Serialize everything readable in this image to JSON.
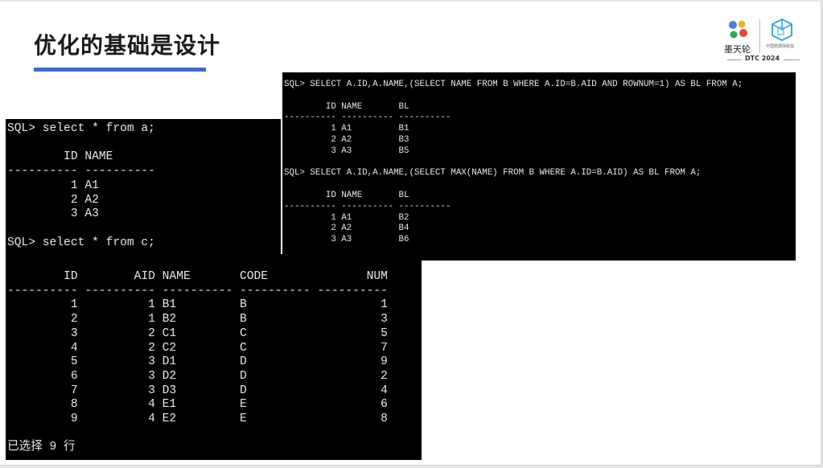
{
  "slide": {
    "title": "优化的基础是设计",
    "accent_color": "#3f6fc4"
  },
  "logos": {
    "brand_name": "墨天轮",
    "org_name": "中国数据库联盟",
    "org_subtitle": "DB China Database Union",
    "event": "DTC 2024"
  },
  "terminal_a": {
    "lines": [
      "SQL> select * from a;",
      "",
      "        ID NAME",
      "---------- ----------",
      "         1 A1",
      "         2 A2",
      "         3 A3",
      "",
      "SQL> select * from c;"
    ]
  },
  "terminal_c": {
    "lines": [
      "        ID        AID NAME       CODE              NUM",
      "---------- ---------- ---------- ---------- ----------",
      "         1          1 B1         B                   1",
      "         2          1 B2         B                   3",
      "         3          2 C1         C                   5",
      "         4          2 C2         C                   7",
      "         5          3 D1         D                   9",
      "         6          3 D2         D                   2",
      "         7          3 D3         D                   4",
      "         8          4 E1         E                   6",
      "         9          4 E2         E                   8",
      "",
      "已选择 9 行"
    ]
  },
  "terminal_subquery": {
    "lines": [
      "SQL> SELECT A.ID,A.NAME,(SELECT NAME FROM B WHERE A.ID=B.AID AND ROWNUM=1) AS BL FROM A;",
      "",
      "        ID NAME       BL",
      "---------- ---------- ----------",
      "         1 A1         B1",
      "         2 A2         B3",
      "         3 A3         B5",
      "",
      "SQL> SELECT A.ID,A.NAME,(SELECT MAX(NAME) FROM B WHERE A.ID=B.AID) AS BL FROM A;",
      "",
      "        ID NAME       BL",
      "---------- ---------- ----------",
      "         1 A1         B2",
      "         2 A2         B4",
      "         3 A3         B6"
    ]
  }
}
